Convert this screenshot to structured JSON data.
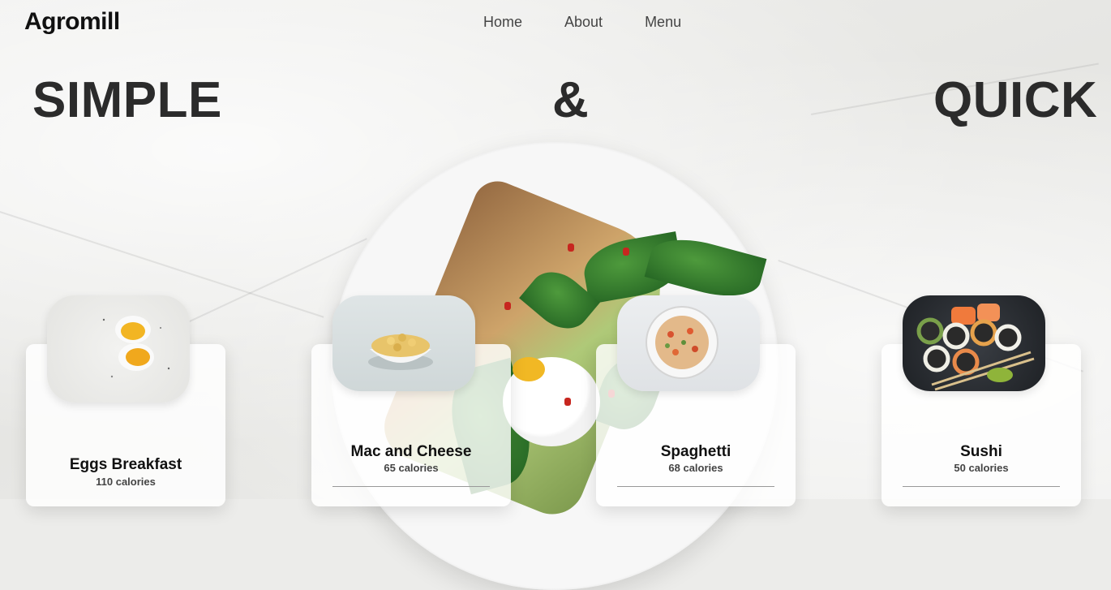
{
  "brand": {
    "name": "Agromill"
  },
  "nav": {
    "items": [
      "Home",
      "About",
      "Menu"
    ]
  },
  "hero": {
    "words": [
      "SIMPLE",
      "&",
      "QUICK"
    ]
  },
  "cards": [
    {
      "name": "Eggs Breakfast",
      "calories": "110 calories",
      "icon": "boiled-eggs"
    },
    {
      "name": "Mac and Cheese",
      "calories": "65 calories",
      "icon": "mac-and-cheese-bowl"
    },
    {
      "name": "Spaghetti",
      "calories": "68 calories",
      "icon": "spaghetti-plate"
    },
    {
      "name": "Sushi",
      "calories": "50 calories",
      "icon": "sushi-rolls"
    }
  ],
  "colors": {
    "text": "#111111",
    "hero": "#2b2b2b",
    "nav": "#444444"
  }
}
